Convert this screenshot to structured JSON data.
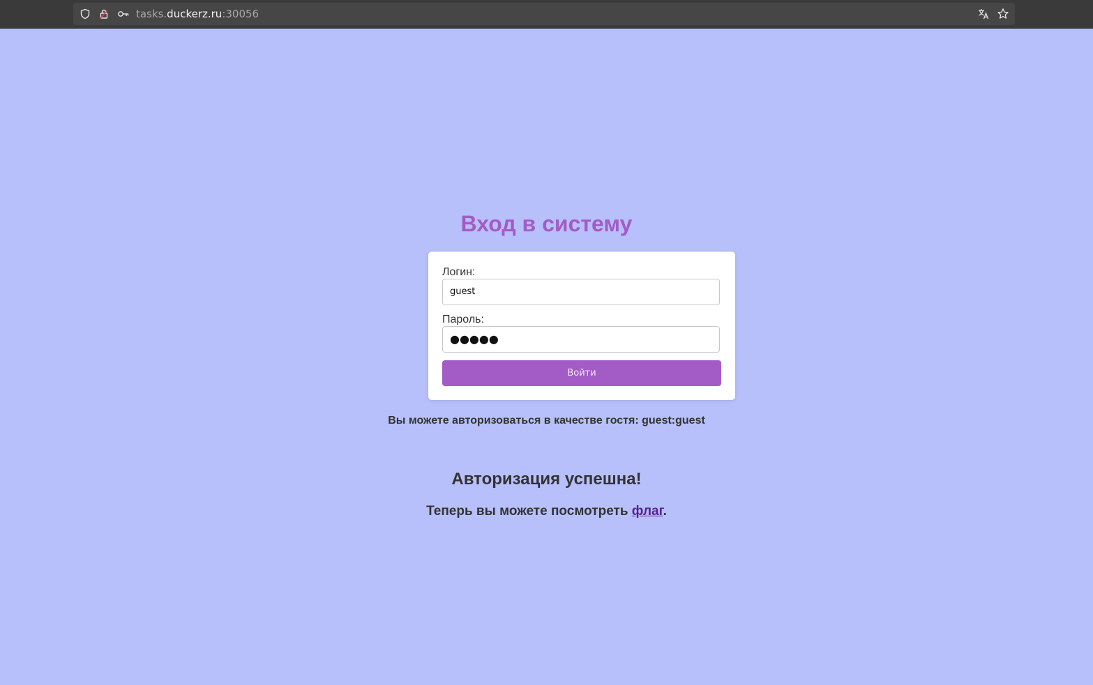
{
  "browser": {
    "url_prefix": "tasks.",
    "url_host": "duckerz.ru",
    "url_port": ":30056",
    "icons": [
      "shield-icon",
      "lock-icon",
      "key-icon",
      "translate-icon",
      "star-icon"
    ]
  },
  "page": {
    "title": "Вход в систему",
    "login_label": "Логин:",
    "login_value": "guest",
    "password_label": "Пароль:",
    "password_mask": "●●●●●",
    "submit_label": "Войти",
    "hint": "Вы можете авторизоваться в качестве гостя: guest:guest",
    "success_title": "Авторизация успешна!",
    "flag_prefix": "Теперь вы можете посмотреть ",
    "flag_link": "флаг",
    "flag_suffix": "."
  },
  "colors": {
    "background": "#b8c0fc",
    "accent": "#a35bc6",
    "link": "#5a218e"
  }
}
